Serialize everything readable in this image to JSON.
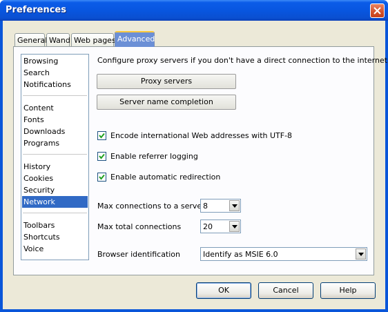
{
  "window": {
    "title": "Preferences"
  },
  "tabs": [
    {
      "label": "General"
    },
    {
      "label": "Wand"
    },
    {
      "label": "Web pages"
    },
    {
      "label": "Advanced",
      "active": true
    }
  ],
  "sidebar": {
    "groups": [
      [
        "Browsing",
        "Search",
        "Notifications"
      ],
      [
        "Content",
        "Fonts",
        "Downloads",
        "Programs"
      ],
      [
        "History",
        "Cookies",
        "Security",
        "Network"
      ],
      [
        "Toolbars",
        "Shortcuts",
        "Voice"
      ]
    ],
    "selected": "Network"
  },
  "network": {
    "proxy_intro": "Configure proxy servers if you don't have a direct connection to the internet",
    "proxy_button": "Proxy servers",
    "server_name_button": "Server name completion",
    "checkboxes": [
      {
        "label": "Encode international Web addresses with UTF-8",
        "checked": true
      },
      {
        "label": "Enable referrer logging",
        "checked": true
      },
      {
        "label": "Enable automatic redirection",
        "checked": true
      }
    ],
    "max_conn_server_label": "Max connections to a server",
    "max_conn_server_value": "8",
    "max_total_label": "Max total connections",
    "max_total_value": "20",
    "browser_id_label": "Browser identification",
    "browser_id_value": "Identify as MSIE 6.0"
  },
  "buttons": {
    "ok": "OK",
    "cancel": "Cancel",
    "help": "Help"
  },
  "colors": {
    "titlebar": "#0856e0",
    "selection": "#316ac5",
    "active_tab": "#6b8fd6",
    "close": "#d2502a"
  }
}
